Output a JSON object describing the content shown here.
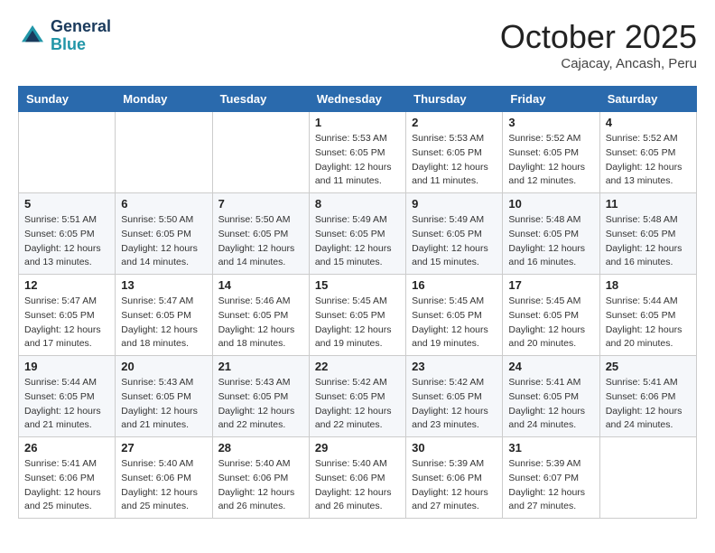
{
  "header": {
    "logo_line1": "General",
    "logo_line2": "Blue",
    "month": "October 2025",
    "location": "Cajacay, Ancash, Peru"
  },
  "weekdays": [
    "Sunday",
    "Monday",
    "Tuesday",
    "Wednesday",
    "Thursday",
    "Friday",
    "Saturday"
  ],
  "weeks": [
    [
      {
        "day": "",
        "info": ""
      },
      {
        "day": "",
        "info": ""
      },
      {
        "day": "",
        "info": ""
      },
      {
        "day": "1",
        "info": "Sunrise: 5:53 AM\nSunset: 6:05 PM\nDaylight: 12 hours\nand 11 minutes."
      },
      {
        "day": "2",
        "info": "Sunrise: 5:53 AM\nSunset: 6:05 PM\nDaylight: 12 hours\nand 11 minutes."
      },
      {
        "day": "3",
        "info": "Sunrise: 5:52 AM\nSunset: 6:05 PM\nDaylight: 12 hours\nand 12 minutes."
      },
      {
        "day": "4",
        "info": "Sunrise: 5:52 AM\nSunset: 6:05 PM\nDaylight: 12 hours\nand 13 minutes."
      }
    ],
    [
      {
        "day": "5",
        "info": "Sunrise: 5:51 AM\nSunset: 6:05 PM\nDaylight: 12 hours\nand 13 minutes."
      },
      {
        "day": "6",
        "info": "Sunrise: 5:50 AM\nSunset: 6:05 PM\nDaylight: 12 hours\nand 14 minutes."
      },
      {
        "day": "7",
        "info": "Sunrise: 5:50 AM\nSunset: 6:05 PM\nDaylight: 12 hours\nand 14 minutes."
      },
      {
        "day": "8",
        "info": "Sunrise: 5:49 AM\nSunset: 6:05 PM\nDaylight: 12 hours\nand 15 minutes."
      },
      {
        "day": "9",
        "info": "Sunrise: 5:49 AM\nSunset: 6:05 PM\nDaylight: 12 hours\nand 15 minutes."
      },
      {
        "day": "10",
        "info": "Sunrise: 5:48 AM\nSunset: 6:05 PM\nDaylight: 12 hours\nand 16 minutes."
      },
      {
        "day": "11",
        "info": "Sunrise: 5:48 AM\nSunset: 6:05 PM\nDaylight: 12 hours\nand 16 minutes."
      }
    ],
    [
      {
        "day": "12",
        "info": "Sunrise: 5:47 AM\nSunset: 6:05 PM\nDaylight: 12 hours\nand 17 minutes."
      },
      {
        "day": "13",
        "info": "Sunrise: 5:47 AM\nSunset: 6:05 PM\nDaylight: 12 hours\nand 18 minutes."
      },
      {
        "day": "14",
        "info": "Sunrise: 5:46 AM\nSunset: 6:05 PM\nDaylight: 12 hours\nand 18 minutes."
      },
      {
        "day": "15",
        "info": "Sunrise: 5:45 AM\nSunset: 6:05 PM\nDaylight: 12 hours\nand 19 minutes."
      },
      {
        "day": "16",
        "info": "Sunrise: 5:45 AM\nSunset: 6:05 PM\nDaylight: 12 hours\nand 19 minutes."
      },
      {
        "day": "17",
        "info": "Sunrise: 5:45 AM\nSunset: 6:05 PM\nDaylight: 12 hours\nand 20 minutes."
      },
      {
        "day": "18",
        "info": "Sunrise: 5:44 AM\nSunset: 6:05 PM\nDaylight: 12 hours\nand 20 minutes."
      }
    ],
    [
      {
        "day": "19",
        "info": "Sunrise: 5:44 AM\nSunset: 6:05 PM\nDaylight: 12 hours\nand 21 minutes."
      },
      {
        "day": "20",
        "info": "Sunrise: 5:43 AM\nSunset: 6:05 PM\nDaylight: 12 hours\nand 21 minutes."
      },
      {
        "day": "21",
        "info": "Sunrise: 5:43 AM\nSunset: 6:05 PM\nDaylight: 12 hours\nand 22 minutes."
      },
      {
        "day": "22",
        "info": "Sunrise: 5:42 AM\nSunset: 6:05 PM\nDaylight: 12 hours\nand 22 minutes."
      },
      {
        "day": "23",
        "info": "Sunrise: 5:42 AM\nSunset: 6:05 PM\nDaylight: 12 hours\nand 23 minutes."
      },
      {
        "day": "24",
        "info": "Sunrise: 5:41 AM\nSunset: 6:05 PM\nDaylight: 12 hours\nand 24 minutes."
      },
      {
        "day": "25",
        "info": "Sunrise: 5:41 AM\nSunset: 6:06 PM\nDaylight: 12 hours\nand 24 minutes."
      }
    ],
    [
      {
        "day": "26",
        "info": "Sunrise: 5:41 AM\nSunset: 6:06 PM\nDaylight: 12 hours\nand 25 minutes."
      },
      {
        "day": "27",
        "info": "Sunrise: 5:40 AM\nSunset: 6:06 PM\nDaylight: 12 hours\nand 25 minutes."
      },
      {
        "day": "28",
        "info": "Sunrise: 5:40 AM\nSunset: 6:06 PM\nDaylight: 12 hours\nand 26 minutes."
      },
      {
        "day": "29",
        "info": "Sunrise: 5:40 AM\nSunset: 6:06 PM\nDaylight: 12 hours\nand 26 minutes."
      },
      {
        "day": "30",
        "info": "Sunrise: 5:39 AM\nSunset: 6:06 PM\nDaylight: 12 hours\nand 27 minutes."
      },
      {
        "day": "31",
        "info": "Sunrise: 5:39 AM\nSunset: 6:07 PM\nDaylight: 12 hours\nand 27 minutes."
      },
      {
        "day": "",
        "info": ""
      }
    ]
  ]
}
